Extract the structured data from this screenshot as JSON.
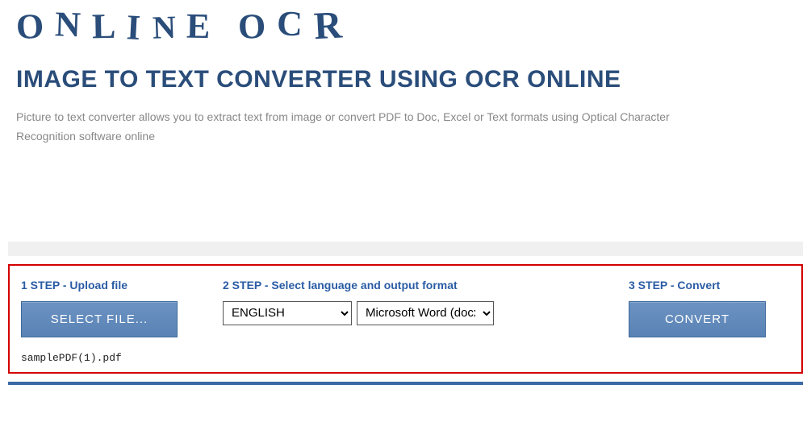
{
  "logo": {
    "text": "ONLINE OCR"
  },
  "page": {
    "title": "IMAGE TO TEXT CONVERTER USING OCR ONLINE",
    "description": "Picture to text converter allows you to extract text from image or convert PDF to Doc, Excel or Text formats using Optical Character Recognition software online"
  },
  "steps": {
    "step1": {
      "label": "1 STEP - Upload file",
      "button": "SELECT FILE...",
      "filename": "samplePDF(1).pdf"
    },
    "step2": {
      "label": "2 STEP - Select language and output format",
      "language_selected": "ENGLISH",
      "format_selected": "Microsoft Word (docx)"
    },
    "step3": {
      "label": "3 STEP - Convert",
      "button": "CONVERT"
    }
  },
  "colors": {
    "brand_dark_blue": "#2a4d7a",
    "link_blue": "#2a5ca5",
    "button_blue": "#5a83b5",
    "highlight_red": "#d40000"
  }
}
